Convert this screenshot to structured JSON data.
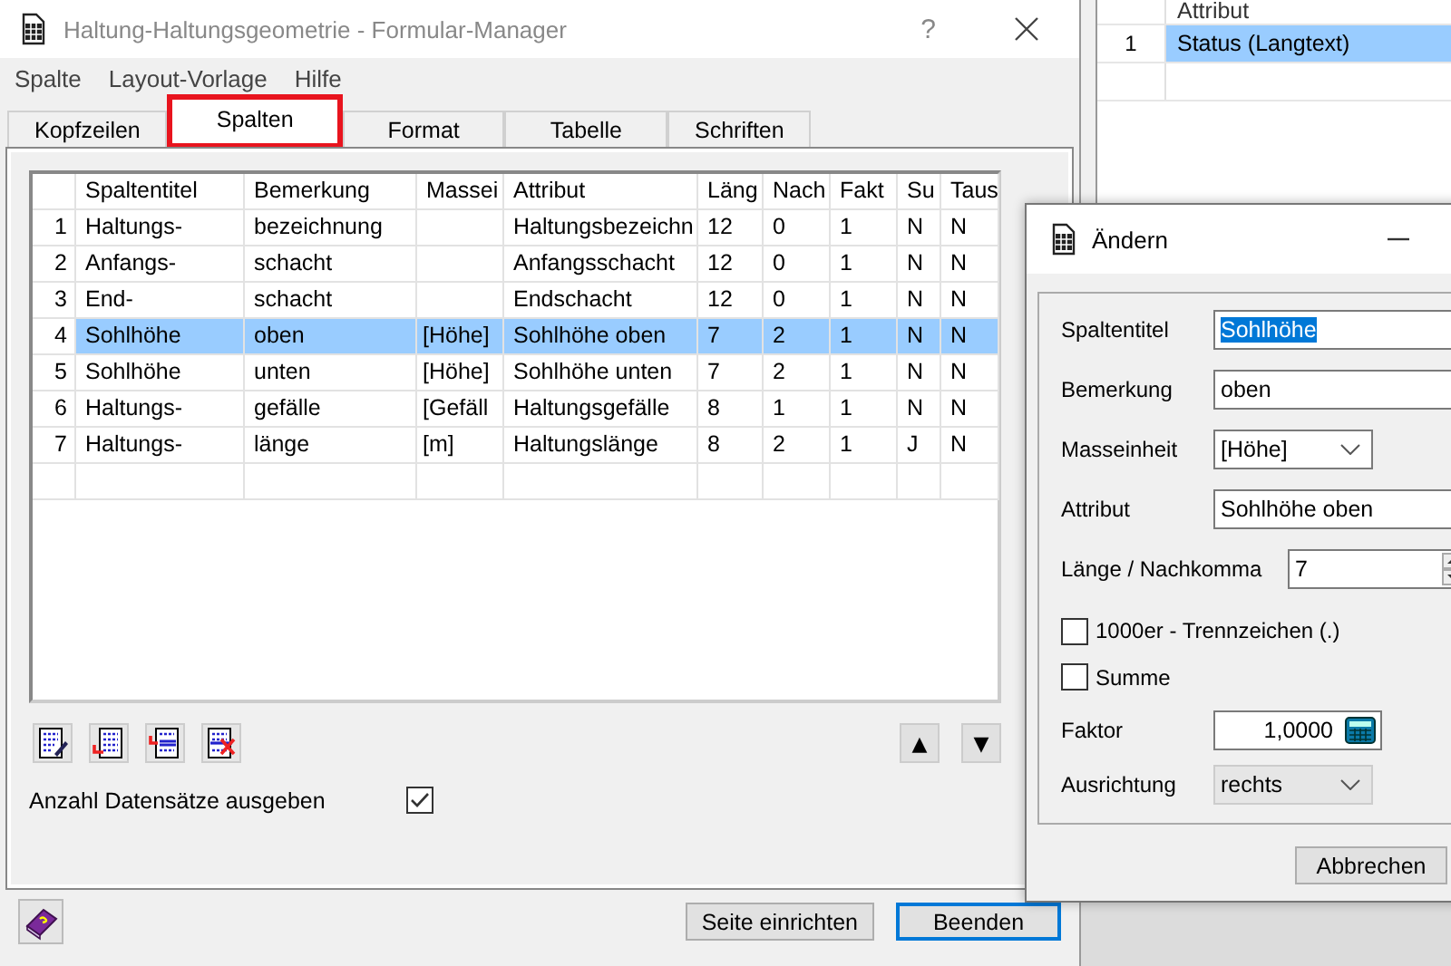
{
  "main_window": {
    "title": "Haltung-Haltungsgeometrie - Formular-Manager",
    "help_glyph": "?",
    "menu": [
      "Spalte",
      "Layout-Vorlage",
      "Hilfe"
    ],
    "tabs": [
      {
        "label": "Kopfzeilen",
        "selected": false
      },
      {
        "label": "Spalten",
        "selected": true
      },
      {
        "label": "Format",
        "selected": false
      },
      {
        "label": "Tabelle",
        "selected": false
      },
      {
        "label": "Schriften",
        "selected": false
      }
    ],
    "table": {
      "columns": [
        "Spaltentitel",
        "Bemerkung",
        "Massei",
        "Attribut",
        "Läng",
        "Nach",
        "Fakt",
        "Su",
        "Taus"
      ],
      "rows": [
        {
          "number": "1",
          "cells": [
            "Haltungs-",
            "bezeichnung",
            "",
            "Haltungsbezeichn",
            "12",
            "0",
            "1",
            "N",
            "N"
          ],
          "selected": false
        },
        {
          "number": "2",
          "cells": [
            "Anfangs-",
            "schacht",
            "",
            "Anfangsschacht",
            "12",
            "0",
            "1",
            "N",
            "N"
          ],
          "selected": false
        },
        {
          "number": "3",
          "cells": [
            "End-",
            "schacht",
            "",
            "Endschacht",
            "12",
            "0",
            "1",
            "N",
            "N"
          ],
          "selected": false
        },
        {
          "number": "4",
          "cells": [
            "Sohlhöhe",
            "oben",
            "[Höhe]",
            "Sohlhöhe oben",
            "7",
            "2",
            "1",
            "N",
            "N"
          ],
          "selected": true
        },
        {
          "number": "5",
          "cells": [
            "Sohlhöhe",
            "unten",
            "[Höhe]",
            "Sohlhöhe unten",
            "7",
            "2",
            "1",
            "N",
            "N"
          ],
          "selected": false
        },
        {
          "number": "6",
          "cells": [
            "Haltungs-",
            "gefälle",
            "[Gefäll",
            "Haltungsgefälle",
            "8",
            "1",
            "1",
            "N",
            "N"
          ],
          "selected": false
        },
        {
          "number": "7",
          "cells": [
            "Haltungs-",
            "länge",
            "[m]",
            "Haltungslänge",
            "8",
            "2",
            "1",
            "J",
            "N"
          ],
          "selected": false
        }
      ]
    },
    "move_buttons": [
      "▲",
      "▼"
    ],
    "row_count_option": {
      "label": "Anzahl Datensätze ausgeben",
      "checked": true
    },
    "buttons": [
      {
        "label": "Seite einrichten",
        "default": false
      },
      {
        "label": "Beenden",
        "default": true
      }
    ]
  },
  "background_window": {
    "table": {
      "columns": [
        "Attribut"
      ],
      "rows": [
        {
          "number": "1",
          "cells": [
            "Status (Langtext)"
          ],
          "selected": true
        }
      ]
    }
  },
  "edit_dialog": {
    "title": "Ändern",
    "fields": [
      {
        "kind": "text",
        "label": "Spaltentitel",
        "value": "Sohlhöhe",
        "highlighted": true,
        "disabled": false
      },
      {
        "kind": "text",
        "label": "Bemerkung",
        "value": "oben",
        "highlighted": false,
        "disabled": false
      },
      {
        "kind": "select",
        "label": "Masseinheit",
        "value": "[Höhe]",
        "highlighted": false,
        "disabled": false
      },
      {
        "kind": "text",
        "label": "Attribut",
        "value": "Sohlhöhe oben",
        "highlighted": false,
        "disabled": false
      },
      {
        "kind": "spinner",
        "label": "Länge / Nachkomma",
        "value": "7",
        "highlighted": false,
        "disabled": false
      },
      {
        "kind": "checkbox",
        "label": "1000er - Trennzeichen (.)",
        "checked": false,
        "highlighted": false,
        "disabled": false
      },
      {
        "kind": "checkbox",
        "label": "Summe",
        "checked": false,
        "highlighted": false,
        "disabled": false
      },
      {
        "kind": "number",
        "label": "Faktor",
        "value": "1,0000",
        "highlighted": false,
        "disabled": false
      },
      {
        "kind": "select",
        "label": "Ausrichtung",
        "value": "rechts",
        "highlighted": false,
        "disabled": true
      }
    ],
    "buttons": [
      "Abbrechen"
    ]
  }
}
